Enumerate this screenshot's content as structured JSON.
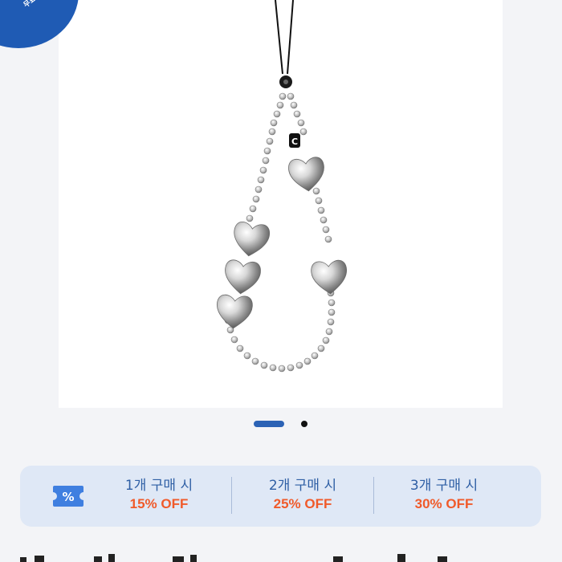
{
  "badge": {
    "text": "무료"
  },
  "product": {
    "image_alt": "heart charm phone strap",
    "charm_letter": "C"
  },
  "carousel": {
    "active_index": 1,
    "total": 2
  },
  "discounts": {
    "icon": "coupon-percent-icon",
    "accent_color": "#2b62b5",
    "tiers": [
      {
        "label": "1개 구매 시",
        "discount": "15% OFF"
      },
      {
        "label": "2개 구매 시",
        "discount": "25% OFF"
      },
      {
        "label": "3개 구매 시",
        "discount": "30% OFF"
      }
    ]
  }
}
